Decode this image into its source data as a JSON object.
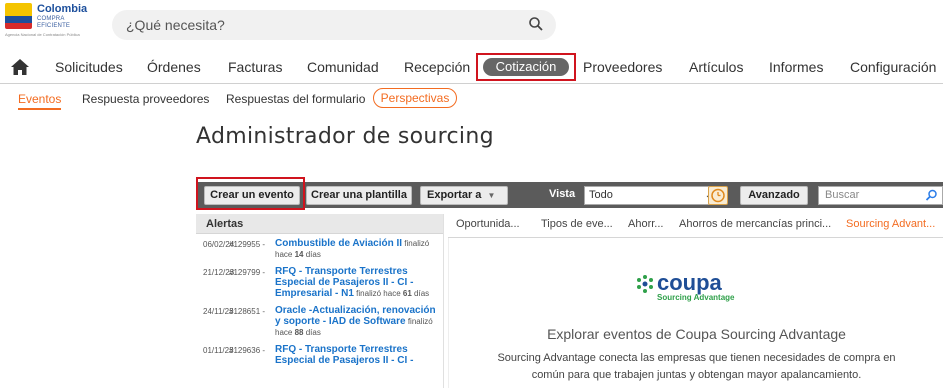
{
  "logo": {
    "title": "Colombia",
    "subtitle": "COMPRA EFICIENTE",
    "tagline": "Agencia Nacional de Contratación Pública"
  },
  "search": {
    "placeholder": "¿Qué necesita?",
    "icon": "search-icon"
  },
  "nav": {
    "home_icon": "home-icon",
    "items": [
      "Solicitudes",
      "Órdenes",
      "Facturas",
      "Comunidad",
      "Recepción",
      "Cotización",
      "Proveedores",
      "Artículos",
      "Informes",
      "Configuración"
    ],
    "active": "Cotización"
  },
  "subnav": {
    "items": [
      "Eventos",
      "Respuesta proveedores",
      "Respuestas del formulario",
      "Perspectivas"
    ],
    "active": "Eventos"
  },
  "page": {
    "title": "Administrador de sourcing"
  },
  "toolbar": {
    "create_event": "Crear un evento",
    "create_template": "Crear una plantilla",
    "export": "Exportar a",
    "view_label": "Vista",
    "view_value": "Todo",
    "advanced": "Avanzado",
    "search_placeholder": "Buscar"
  },
  "alerts": {
    "header": "Alertas",
    "items": [
      {
        "date": "06/02/24",
        "id": "#129955 -",
        "title": "Combustible de Aviación II",
        "status": "finalizó hace",
        "days": "14",
        "unit": "días"
      },
      {
        "date": "21/12/23",
        "id": "#129799 -",
        "title": "RFQ - Transporte Terrestres Especial de Pasajeros II - CI - Empresarial - N1",
        "status": "finalizó hace",
        "days": "61",
        "unit": "días"
      },
      {
        "date": "24/11/23",
        "id": "#128651 -",
        "title": "Oracle -Actualización, renovación y soporte - IAD de Software",
        "status": "finalizó hace",
        "days": "88",
        "unit": "días"
      },
      {
        "date": "01/11/23",
        "id": "#129636 -",
        "title": "RFQ - Transporte Terrestres Especial de Pasajeros II - CI -",
        "status": "",
        "days": "",
        "unit": ""
      }
    ]
  },
  "tabs": [
    "Oportunida...",
    "Tipos de eve...",
    "Ahorr...",
    "Ahorros de mercancías princi...",
    "Sourcing Advant..."
  ],
  "tabs_active": "Sourcing Advant...",
  "content": {
    "brand": "coupa",
    "brand_sub": "Sourcing Advantage",
    "heading": "Explorar eventos de Coupa Sourcing Advantage",
    "description": "Sourcing Advantage conecta las empresas que tienen necesidades de compra en común para que trabajen juntas y obtengan mayor apalancamiento."
  },
  "colors": {
    "accent": "#f36c21",
    "highlight": "#d0141e",
    "link": "#1a73c9",
    "toolbar": "#5b5b5b"
  }
}
